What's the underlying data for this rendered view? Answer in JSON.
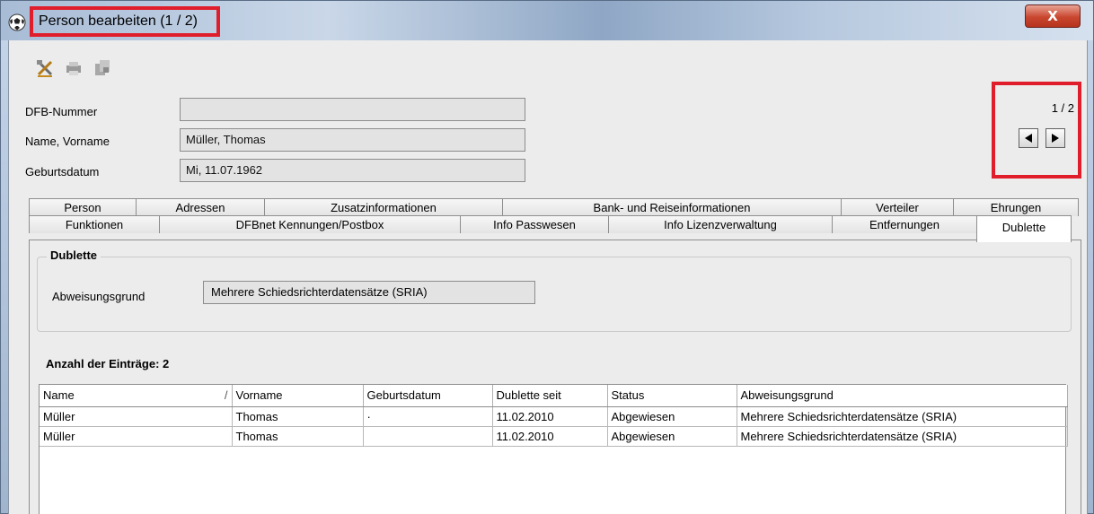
{
  "window": {
    "title": "Person bearbeiten (1 / 2)",
    "close_label": "X"
  },
  "toolbar": {
    "icons": [
      "tools-icon",
      "print-icon",
      "export-icon"
    ]
  },
  "fields": [
    {
      "label": "DFB-Nummer",
      "value": ""
    },
    {
      "label": "Name, Vorname",
      "value": "Müller, Thomas"
    },
    {
      "label": "Geburtsdatum",
      "value": "Mi, 11.07.1962"
    }
  ],
  "navigator": {
    "count": "1 / 2"
  },
  "tabs_row1": [
    {
      "label": "Person",
      "width": 120
    },
    {
      "label": "Adressen",
      "width": 144
    },
    {
      "label": "Zusatzinformationen",
      "width": 266
    },
    {
      "label": "Bank- und Reiseinformationen",
      "width": 378
    },
    {
      "label": "Verteiler",
      "width": 126
    },
    {
      "label": "Ehrungen",
      "width": 140
    }
  ],
  "tabs_row2": [
    {
      "label": "Funktionen",
      "width": 146
    },
    {
      "label": "DFBnet Kennungen/Postbox",
      "width": 336
    },
    {
      "label": "Info Passwesen",
      "width": 166
    },
    {
      "label": "Info Lizenzverwaltung",
      "width": 250
    },
    {
      "label": "Entfernungen",
      "width": 162
    },
    {
      "label": "Dublette",
      "width": 106,
      "active": true
    }
  ],
  "panel": {
    "group_title": "Dublette",
    "reason_label": "Abweisungsgrund",
    "reason_value": "Mehrere Schiedsrichterdatensätze (SRIA)",
    "count_text": "Anzahl der Einträge: 2"
  },
  "table": {
    "columns": [
      "Name",
      "Vorname",
      "Geburtsdatum",
      "Dublette seit",
      "Status",
      "Abweisungsgrund"
    ],
    "sort_indicator": "/",
    "rows": [
      [
        "Müller",
        "Thomas",
        "·",
        "11.02.2010",
        "Abgewiesen",
        "Mehrere Schiedsrichterdatensätze (SRIA)"
      ],
      [
        "Müller",
        "Thomas",
        "",
        "11.02.2010",
        "Abgewiesen",
        "Mehrere Schiedsrichterdatensätze (SRIA)"
      ]
    ]
  },
  "colors": {
    "highlight_red": "#e01d2b",
    "close_red": "#c9462f"
  }
}
